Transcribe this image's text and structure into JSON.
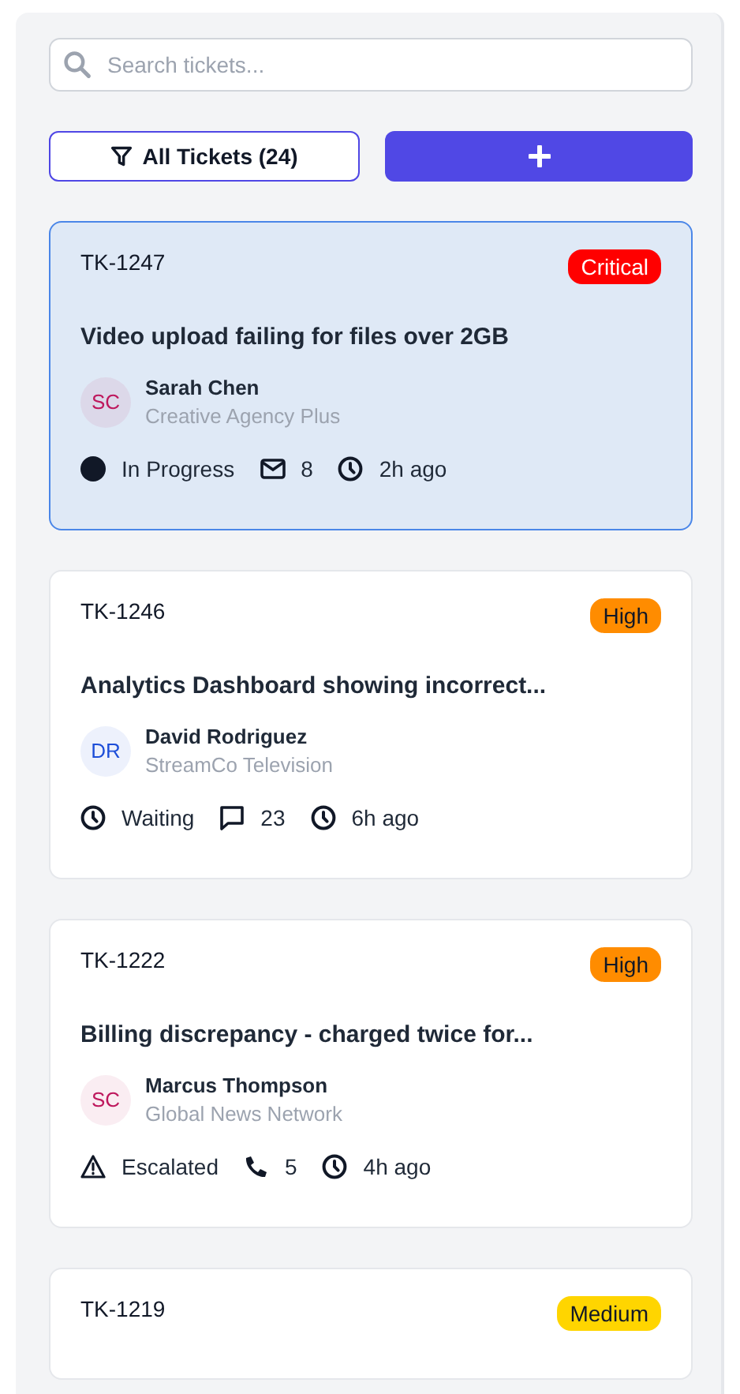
{
  "search": {
    "placeholder": "Search tickets..."
  },
  "filter_button": {
    "label": "All Tickets (24)"
  },
  "tickets": [
    {
      "id": "TK-1247",
      "priority": {
        "label": "Critical",
        "color": "#ff0000"
      },
      "selected": true,
      "title": "Video upload failing for files over 2GB",
      "avatar": {
        "initials": "SC",
        "color": "#be185d"
      },
      "name": "Sarah Chen",
      "company": "Creative Agency Plus",
      "status": {
        "kind": "progress",
        "label": "In Progress"
      },
      "channel": {
        "kind": "mail",
        "count": "8"
      },
      "time": "2h ago"
    },
    {
      "id": "TK-1246",
      "priority": {
        "label": "High",
        "color": "#ff8c00"
      },
      "selected": false,
      "title": "Analytics Dashboard showing incorrect...",
      "avatar": {
        "initials": "DR",
        "color": "#1d4ed8"
      },
      "name": "David Rodriguez",
      "company": "StreamCo Television",
      "status": {
        "kind": "waiting",
        "label": "Waiting"
      },
      "channel": {
        "kind": "chat",
        "count": "23"
      },
      "time": "6h ago"
    },
    {
      "id": "TK-1222",
      "priority": {
        "label": "High",
        "color": "#ff8c00"
      },
      "selected": false,
      "title": "Billing discrepancy - charged twice for...",
      "avatar": {
        "initials": "SC",
        "color": "#be185d"
      },
      "name": "Marcus Thompson",
      "company": "Global News Network",
      "status": {
        "kind": "escalated",
        "label": "Escalated"
      },
      "channel": {
        "kind": "phone",
        "count": "5"
      },
      "time": "4h ago"
    },
    {
      "id": "TK-1219",
      "priority": {
        "label": "Medium",
        "color": "#ffd500"
      },
      "selected": false
    }
  ]
}
